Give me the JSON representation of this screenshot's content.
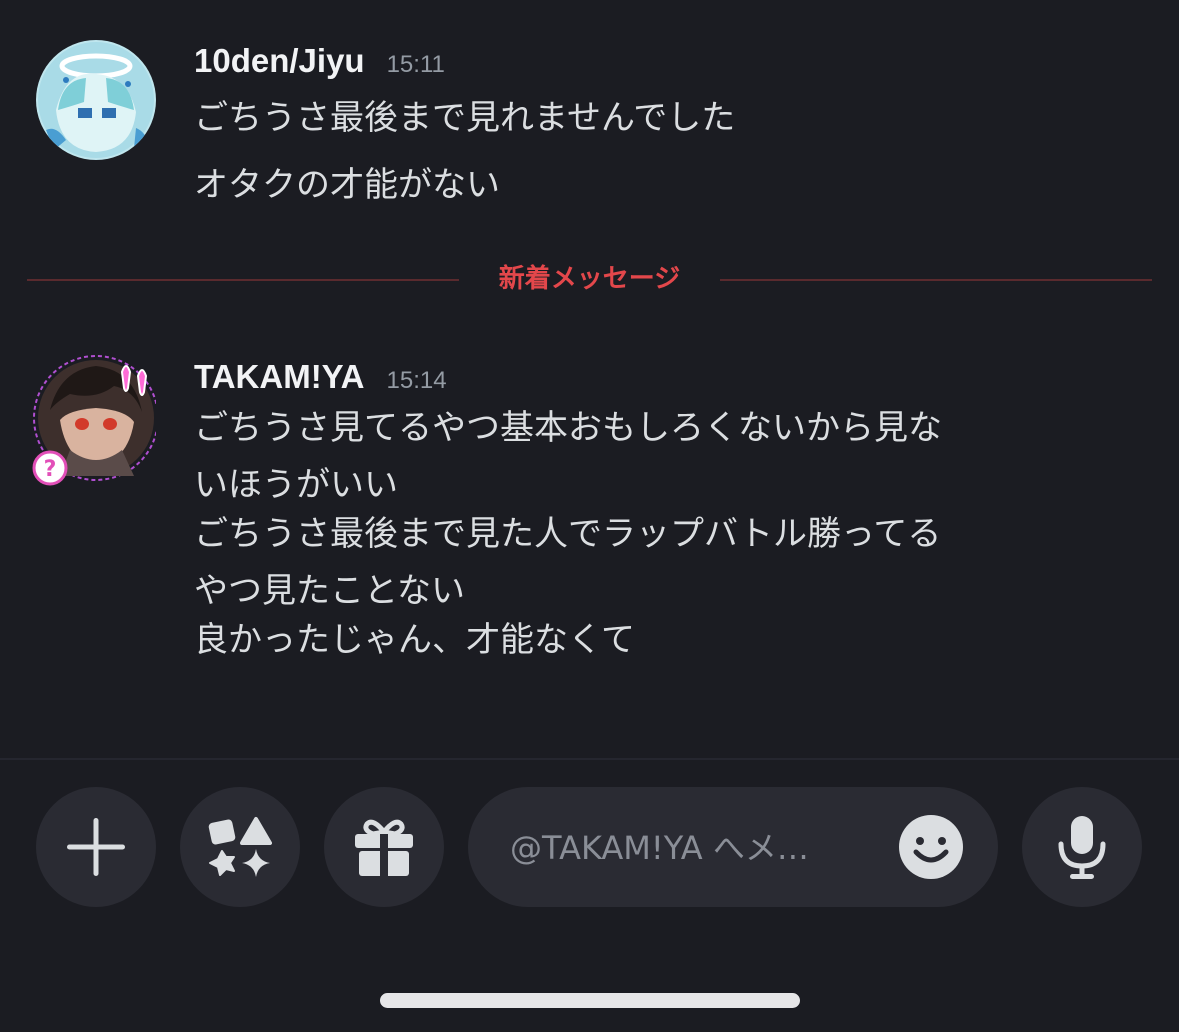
{
  "messages": [
    {
      "username": "10den/Jiyu",
      "timestamp": "15:11",
      "lines": [
        "ごちうさ最後まで見れませんでした",
        "オタクの才能がない"
      ]
    },
    {
      "username": "TAKAM!YA",
      "timestamp": "15:14",
      "lines": [
        "ごちうさ見てるやつ基本おもしろくないから見な",
        "いほうがいい",
        "ごちうさ最後まで見た人でラップバトル勝ってる",
        "やつ見たことない",
        "良かったじゃん、才能なくて"
      ]
    }
  ],
  "divider": {
    "label": "新着メッセージ",
    "color": "#e3474b"
  },
  "input": {
    "placeholder": "@TAKAM!YA へメ…"
  },
  "icons": {
    "add": "plus-icon",
    "apps": "apps-icon",
    "gift": "gift-icon",
    "emoji": "smile-emoji-icon",
    "mic": "microphone-icon"
  },
  "colors": {
    "background": "#1b1c22",
    "button_bg": "#2a2b33",
    "accent_new": "#e3474b",
    "icon": "#dbdee1"
  }
}
